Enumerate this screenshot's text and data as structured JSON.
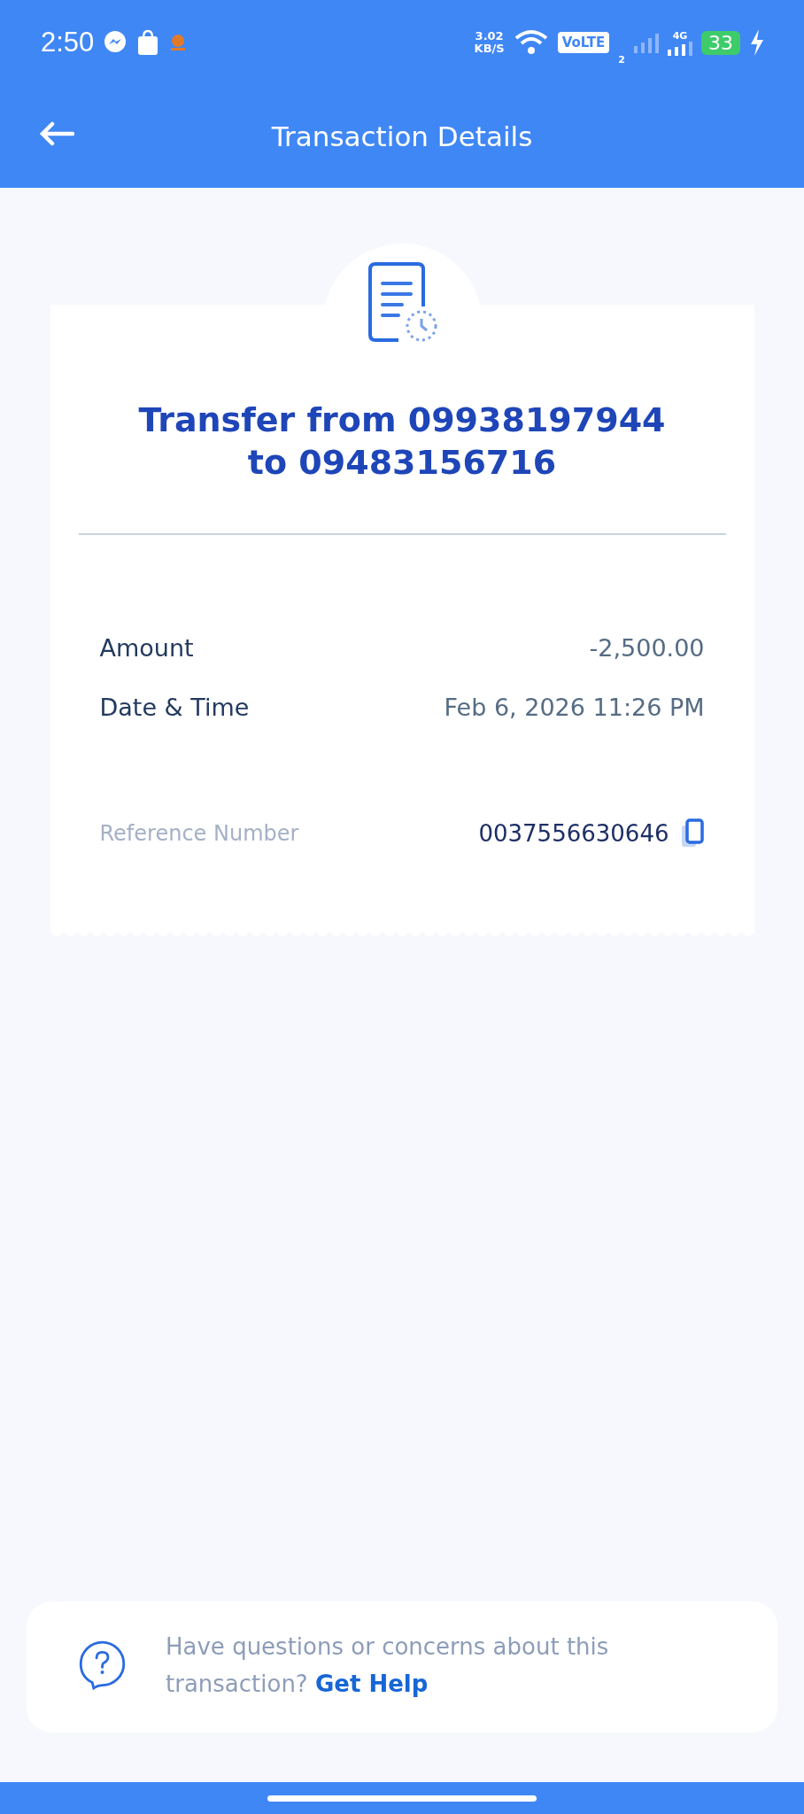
{
  "status_bar": {
    "time": "2:50",
    "speed_value": "3.02",
    "speed_unit": "KB/S",
    "volte": "VoLTE",
    "sim_index": "2",
    "network": "4G",
    "battery": "33"
  },
  "header": {
    "title": "Transaction Details"
  },
  "transaction": {
    "title": "Transfer from 09938197944 to 09483156716",
    "details": [
      {
        "label": "Amount",
        "value": "-2,500.00"
      },
      {
        "label": "Date & Time",
        "value": "Feb 6, 2026 11:26 PM"
      }
    ],
    "reference": {
      "label": "Reference Number",
      "value": "0037556630646"
    }
  },
  "help": {
    "text": "Have questions or concerns about this transaction?",
    "link": "Get Help"
  }
}
